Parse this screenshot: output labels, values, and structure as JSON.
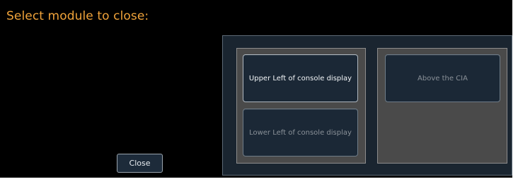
{
  "dialog": {
    "title": "Select module to close:",
    "close_label": "Close"
  },
  "modules": {
    "upper_left": "Upper Left of console display",
    "lower_left": "Lower Left of console display",
    "above_cia": "Above the CIA"
  },
  "colors": {
    "title": "#f0a33a",
    "background": "#000000",
    "button_fill": "#1b2836",
    "group_fill": "#4a4a4a",
    "frame_fill": "#1a2530"
  }
}
